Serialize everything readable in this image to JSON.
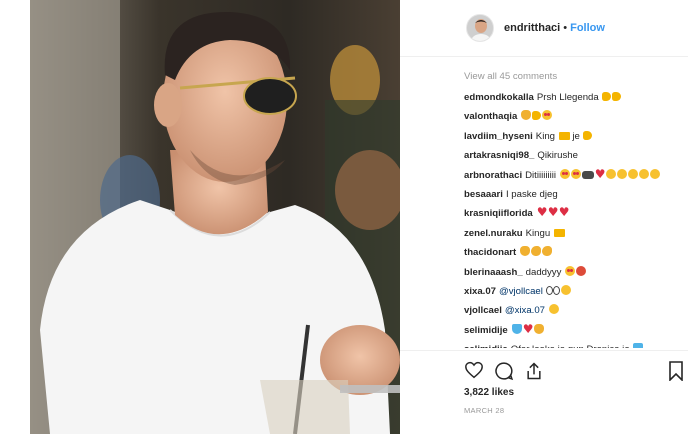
{
  "post": {
    "username": "endritthaci",
    "separator": "•",
    "follow_label": "Follow",
    "view_all": "View all 45 comments",
    "likes": "3,822 likes",
    "date": "MARCH 28"
  },
  "comments": [
    {
      "user": "edmondkokalla",
      "text": "Prsh Llegenda",
      "emoji": [
        "thumb",
        "thumb"
      ]
    },
    {
      "user": "valonthaqia",
      "text": "",
      "emoji": [
        "ok",
        "thumb",
        "hearteyes"
      ]
    },
    {
      "user": "lavdiim_hyseni",
      "text": "King",
      "emoji": [
        "crown"
      ],
      "text2": "je",
      "emoji2": [
        "thumb"
      ]
    },
    {
      "user": "artakrasniqi98_",
      "text": "Qikirushe",
      "emoji": []
    },
    {
      "user": "arbnorathaci",
      "text": "Ditiiiiiiiii",
      "emoji": [
        "hearteyes",
        "hearteyes",
        "car",
        "heart",
        "smirk",
        "smirk",
        "smirk",
        "smirk",
        "smirk"
      ]
    },
    {
      "user": "besaaari",
      "text": "I paske djeg",
      "emoji": []
    },
    {
      "user": "krasniqiiflorida",
      "text": "",
      "emoji": [
        "heart",
        "heart",
        "heart"
      ]
    },
    {
      "user": "zenel.nuraku",
      "text": "Kingu",
      "emoji": [
        "crown"
      ]
    },
    {
      "user": "thacidonart",
      "text": "",
      "emoji": [
        "ok",
        "muscle",
        "muscle"
      ]
    },
    {
      "user": "blerinaaash_",
      "text": "daddyyy",
      "emoji": [
        "hearteyes",
        "devil"
      ]
    },
    {
      "user": "xixa.07",
      "mention": "@vjollcael",
      "text": "",
      "emoji": [
        "eyes",
        "eyes",
        "smirk"
      ]
    },
    {
      "user": "vjollcael",
      "mention": "@xixa.07",
      "text": "",
      "emoji": [
        "smirk"
      ]
    },
    {
      "user": "selimidije",
      "text": "",
      "emoji": [
        "gem",
        "heart",
        "ok"
      ]
    },
    {
      "user": "selimidije",
      "text": "Ofar looke je qun Drenice je",
      "emoji": [
        "gem"
      ]
    }
  ],
  "icons": {
    "like": "heart-outline-icon",
    "comment": "comment-bubble-icon",
    "share": "share-icon",
    "save": "bookmark-icon"
  },
  "colors": {
    "follow": "#3897f0",
    "mention": "#003569",
    "muted": "#999999"
  }
}
